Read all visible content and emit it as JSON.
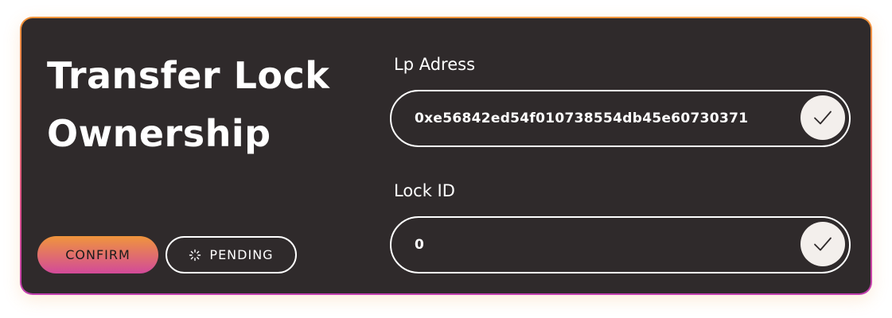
{
  "card": {
    "title_line1": "Transfer Lock",
    "title_line2": "Ownership"
  },
  "actions": {
    "confirm_label": "CONFIRM",
    "pending_label": "PENDING",
    "pending_icon": "spinner-icon"
  },
  "fields": {
    "lp_address": {
      "label": "Lp Adress",
      "value": "0xe56842ed54f010738554db45e60730371",
      "icon": "check-icon"
    },
    "lock_id": {
      "label": "Lock ID",
      "value": "0",
      "icon": "check-icon"
    }
  },
  "colors": {
    "card_background": "#2f2a2b",
    "accent_orange": "#f0953c",
    "accent_pink": "#d24a9a",
    "check_circle": "#f3efec"
  }
}
